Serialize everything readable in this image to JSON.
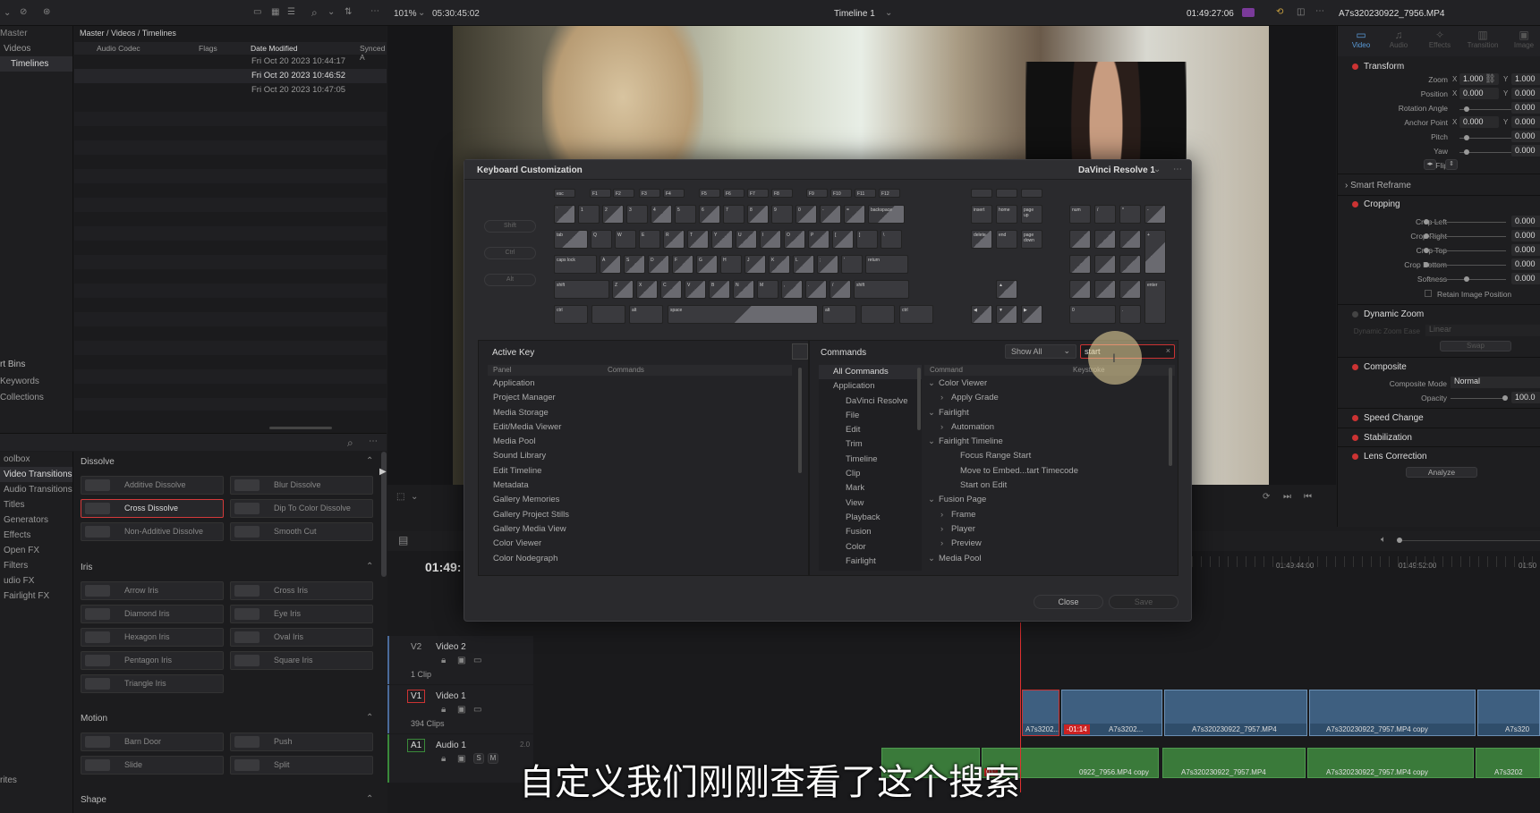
{
  "colors": {
    "accent": "#d33a3a",
    "clip_blue": "#3e5f80",
    "clip_green": "#3a7a3a",
    "playhead": "#e03030"
  },
  "media_pool": {
    "zoom_menu_icon": "chevron-down-icon",
    "bins": [
      "Master",
      "Videos",
      "Timelines"
    ],
    "breadcrumb": "Master / Videos / Timelines",
    "columns": [
      "Audio Codec",
      "Flags",
      "Date Modified",
      "Synced A"
    ],
    "rows": [
      "Fri Oct 20 2023 10:44:17",
      "Fri Oct 20 2023 10:46:52",
      "Fri Oct 20 2023 10:47:05"
    ],
    "smart_bins_title": "rt Bins",
    "smart_bins": [
      "Keywords",
      "Collections"
    ]
  },
  "effects": {
    "tree": [
      "oolbox",
      "Video Transitions",
      "Audio Transitions",
      "Titles",
      "Generators",
      "Effects",
      "Open FX",
      "Filters",
      "udio FX",
      "Fairlight FX"
    ],
    "favorites": "rites",
    "categories": {
      "dissolve": "Dissolve",
      "iris": "Iris",
      "motion": "Motion",
      "shape": "Shape"
    },
    "dissolve": [
      "Additive Dissolve",
      "Blur Dissolve",
      "Cross Dissolve",
      "Dip To Color Dissolve",
      "Non-Additive Dissolve",
      "Smooth Cut"
    ],
    "iris": [
      "Arrow Iris",
      "Cross Iris",
      "Diamond Iris",
      "Eye Iris",
      "Hexagon Iris",
      "Oval Iris",
      "Pentagon Iris",
      "Square Iris",
      "Triangle Iris"
    ],
    "motion": [
      "Barn Door",
      "Push",
      "Slide",
      "Split"
    ]
  },
  "viewer": {
    "zoom": "101%",
    "source_tc": "05:30:45:02",
    "timeline_name": "Timeline 1",
    "record_tc": "01:49:27:06",
    "clip_name": "A7s320230922_7956.MP4"
  },
  "dialog": {
    "title": "Keyboard Customization",
    "preset": "DaVinci Resolve 1",
    "modifiers": [
      "Shift",
      "Ctrl",
      "Alt"
    ],
    "active_key_title": "Active Key",
    "active_cols": [
      "Panel",
      "Commands"
    ],
    "panels": [
      "Application",
      "Project Manager",
      "Media Storage",
      "Edit/Media Viewer",
      "Media Pool",
      "Sound Library",
      "Edit Timeline",
      "Metadata",
      "Gallery Memories",
      "Gallery Project Stills",
      "Gallery Media View",
      "Color Viewer",
      "Color Nodegraph"
    ],
    "commands_title": "Commands",
    "show_all": "Show All",
    "search_value": "start",
    "cmd_tree": [
      "All Commands",
      "Application",
      "DaVinci Resolve",
      "File",
      "Edit",
      "Trim",
      "Timeline",
      "Clip",
      "Mark",
      "View",
      "Playback",
      "Fusion",
      "Color",
      "Fairlight"
    ],
    "cmd_cols": [
      "Command",
      "Keystroke"
    ],
    "cmd_results": [
      {
        "t": "Color Viewer",
        "lvl": 0,
        "open": true
      },
      {
        "t": "Apply Grade",
        "lvl": 1,
        "open": false
      },
      {
        "t": "Fairlight",
        "lvl": 0,
        "open": true
      },
      {
        "t": "Automation",
        "lvl": 1,
        "open": false
      },
      {
        "t": "Fairlight Timeline",
        "lvl": 0,
        "open": true
      },
      {
        "t": "Focus Range Start",
        "lvl": 2
      },
      {
        "t": "Move to Embed...tart Timecode",
        "lvl": 2
      },
      {
        "t": "Start on Edit",
        "lvl": 2
      },
      {
        "t": "Fusion Page",
        "lvl": 0,
        "open": true
      },
      {
        "t": "Frame",
        "lvl": 1,
        "open": false
      },
      {
        "t": "Player",
        "lvl": 1,
        "open": false
      },
      {
        "t": "Preview",
        "lvl": 1,
        "open": false
      },
      {
        "t": "Media Pool",
        "lvl": 0,
        "open": true
      }
    ],
    "close_label": "Close",
    "save_label": "Save",
    "keys": {
      "fn": [
        "esc",
        "F1",
        "F2",
        "F3",
        "F4",
        "F5",
        "F6",
        "F7",
        "F8",
        "F9",
        "F10",
        "F11",
        "F12"
      ],
      "row1": [
        "`",
        "1",
        "2",
        "3",
        "4",
        "5",
        "6",
        "7",
        "8",
        "9",
        "0",
        "-",
        "=",
        "backspace"
      ],
      "row2": [
        "tab",
        "Q",
        "W",
        "E",
        "R",
        "T",
        "Y",
        "U",
        "I",
        "O",
        "P",
        "[",
        "]",
        "\\"
      ],
      "row3": [
        "caps lock",
        "A",
        "S",
        "D",
        "F",
        "G",
        "H",
        "J",
        "K",
        "L",
        ";",
        "'",
        "return"
      ],
      "row4": [
        "shift",
        "Z",
        "X",
        "C",
        "V",
        "B",
        "N",
        "M",
        ",",
        ".",
        "/",
        "shift"
      ],
      "row5": [
        "ctrl",
        "alt",
        "space",
        "alt",
        "ctrl"
      ],
      "nav": [
        "insert",
        "home",
        "page up",
        "delete",
        "end",
        "page down"
      ],
      "numpad_top": [
        "num",
        "/",
        "*",
        "-"
      ],
      "enter": "enter"
    }
  },
  "inspector": {
    "tabs": [
      "Video",
      "Audio",
      "Effects",
      "Transition",
      "Image"
    ],
    "transform": "Transform",
    "labels": {
      "zoom": "Zoom",
      "position": "Position",
      "rotation": "Rotation Angle",
      "anchor": "Anchor Point",
      "pitch": "Pitch",
      "yaw": "Yaw",
      "flip": "Flip"
    },
    "values": {
      "zoom_x": "1.000",
      "zoom_y": "1.000",
      "pos_x": "0.000",
      "pos_y": "0.000",
      "rot": "0.000",
      "anchor_x": "0.000",
      "anchor_y": "0.000",
      "pitch": "0.000",
      "yaw": "0.000"
    },
    "smart_reframe": "Smart Reframe",
    "cropping": "Cropping",
    "crop_labels": [
      "Crop Left",
      "Crop Right",
      "Crop Top",
      "Crop Bottom",
      "Softness"
    ],
    "crop_values": [
      "0.000",
      "0.000",
      "0.000",
      "0.000",
      "0.000"
    ],
    "retain": "Retain Image Position",
    "dynamic_zoom": "Dynamic Zoom",
    "dz_ease": "Dynamic Zoom Ease",
    "dz_value": "Linear",
    "swap": "Swap",
    "composite": "Composite",
    "comp_mode_label": "Composite Mode",
    "comp_mode": "Normal",
    "opacity_label": "Opacity",
    "opacity": "100.0",
    "speed_change": "Speed Change",
    "stabilization": "Stabilization",
    "lens": "Lens Correction",
    "analyze": "Analyze"
  },
  "timeline": {
    "timecode": "01:49:",
    "ruler": [
      "01:49:44:00",
      "01:49:52:00",
      "01:50"
    ],
    "tracks": [
      {
        "id": "V2",
        "name": "Video 2",
        "info": "1 Clip"
      },
      {
        "id": "V1",
        "name": "Video 1",
        "info": "394 Clips"
      },
      {
        "id": "A1",
        "name": "Audio 1",
        "info": "2.0"
      }
    ],
    "video_clips": [
      "A7s3202...",
      "A7s3202...",
      "A7s320230922_7957.MP4",
      "A7s320230922_7957.MP4 copy",
      "A7s320"
    ],
    "clip_marker": "-01:14",
    "audio_clips": [
      "0922_7956.MP4 copy",
      "A7s320230922_7957.MP4",
      "A7s320230922_7957.MP4 copy",
      "A7s3202"
    ],
    "audio_marker": "01:",
    "track_btn_s": "S",
    "track_btn_m": "M"
  },
  "subtitle": "自定义我们刚刚查看了这个搜索"
}
